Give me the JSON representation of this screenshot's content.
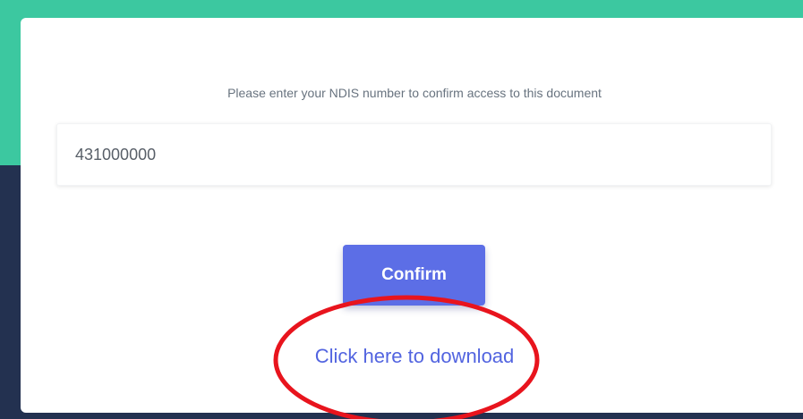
{
  "prompt_text": "Please enter your NDIS number to confirm access to this document",
  "ndis_input": {
    "value": "431000000"
  },
  "confirm_label": "Confirm",
  "download_link_text": "Click here to download",
  "colors": {
    "header_teal": "#3cc8a0",
    "footer_navy": "#233150",
    "button": "#5c6ee6",
    "link": "#5264e0",
    "annotation": "#e8141d"
  }
}
